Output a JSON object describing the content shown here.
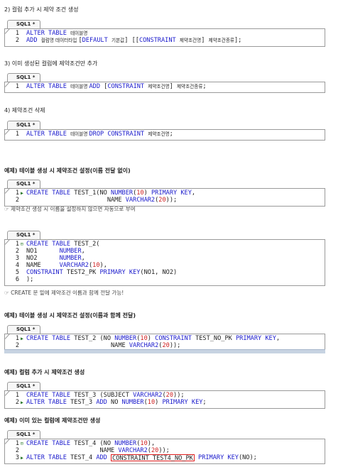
{
  "sections": {
    "s2": {
      "heading": "2) 컬럼 추가 시 제약 조건 생성",
      "tab": "SQL1 *",
      "lines": [
        {
          "n": "1",
          "parts": [
            [
              "kw",
              "ALTER TABLE "
            ],
            [
              "ko",
              "테이블명"
            ]
          ]
        },
        {
          "n": "2",
          "parts": [
            [
              "kw",
              "ADD "
            ],
            [
              "ko",
              "컬럼명 데이터타입 "
            ],
            [
              "txt",
              "["
            ],
            [
              "kw",
              "DEFAULT "
            ],
            [
              "ko",
              "기본값"
            ],
            [
              "txt",
              "] [["
            ],
            [
              "kw",
              "CONSTRAINT "
            ],
            [
              "ko",
              "제약조건명"
            ],
            [
              "txt",
              "] "
            ],
            [
              "ko",
              "제약조건종류"
            ],
            [
              "txt",
              "];"
            ]
          ]
        }
      ]
    },
    "s3": {
      "heading": "3) 이미 생성된 컬럼에 제약조건만 추가",
      "tab": "SQL1 *",
      "lines": [
        {
          "n": "1",
          "parts": [
            [
              "kw",
              "ALTER TABLE "
            ],
            [
              "ko",
              "테이블명 "
            ],
            [
              "kw",
              "ADD "
            ],
            [
              "txt",
              "["
            ],
            [
              "kw",
              "CONSTRAINT "
            ],
            [
              "ko",
              "제약조건명"
            ],
            [
              "txt",
              "] "
            ],
            [
              "ko",
              "제약조건종류"
            ],
            [
              "txt",
              ";"
            ]
          ]
        }
      ]
    },
    "s4": {
      "heading": "4) 제약조건 삭제",
      "tab": "SQL1 *",
      "lines": [
        {
          "n": "1",
          "parts": [
            [
              "kw",
              "ALTER TABLE "
            ],
            [
              "ko",
              "테이블명 "
            ],
            [
              "kw",
              "DROP CONSTRAINT "
            ],
            [
              "ko",
              "제약조건명"
            ],
            [
              "txt",
              ";"
            ]
          ]
        }
      ]
    },
    "ex1": {
      "heading": "예제) 테이블 생성 시 제약조건 설정(이름 전달 없이)",
      "tab": "SQL1 *",
      "lines": [
        {
          "n": "1",
          "mk": "▶",
          "parts": [
            [
              "kw",
              "CREATE TABLE "
            ],
            [
              "txt",
              "TEST_1(NO "
            ],
            [
              "kw",
              "NUMBER"
            ],
            [
              "txt",
              "("
            ],
            [
              "num",
              "10"
            ],
            [
              "txt",
              ") "
            ],
            [
              "kw",
              "PRIMARY KEY"
            ],
            [
              "txt",
              ","
            ]
          ]
        },
        {
          "n": "2",
          "parts": [
            [
              "txt",
              "                      NAME "
            ],
            [
              "kw",
              "VARCHAR2"
            ],
            [
              "txt",
              "("
            ],
            [
              "num",
              "20"
            ],
            [
              "txt",
              "));"
            ]
          ]
        }
      ],
      "note": "☞ 제약조건 생성 시 이름을 설정하지 않으면 자동으로 부여"
    },
    "ex2": {
      "tab": "SQL1 *",
      "lines": [
        {
          "n": "1",
          "mk": "⊟",
          "parts": [
            [
              "kw",
              "CREATE TABLE "
            ],
            [
              "txt",
              "TEST_2("
            ]
          ]
        },
        {
          "n": "2",
          "parts": [
            [
              "txt",
              "NO1      "
            ],
            [
              "kw",
              "NUMBER"
            ],
            [
              "txt",
              ","
            ]
          ]
        },
        {
          "n": "3",
          "parts": [
            [
              "txt",
              "NO2      "
            ],
            [
              "kw",
              "NUMBER"
            ],
            [
              "txt",
              ","
            ]
          ]
        },
        {
          "n": "4",
          "parts": [
            [
              "txt",
              "NAME     "
            ],
            [
              "kw",
              "VARCHAR2"
            ],
            [
              "txt",
              "("
            ],
            [
              "num",
              "10"
            ],
            [
              "txt",
              "),"
            ]
          ]
        },
        {
          "n": "5",
          "parts": [
            [
              "kw",
              "CONSTRAINT "
            ],
            [
              "txt",
              "TEST2_PK "
            ],
            [
              "kw",
              "PRIMARY KEY"
            ],
            [
              "txt",
              "(NO1, NO2)"
            ]
          ]
        },
        {
          "n": "6",
          "parts": [
            [
              "txt",
              ");"
            ]
          ]
        }
      ],
      "note": "☞ CREATE 문 밑에 제약조건 이름과 함께 전달 가능!"
    },
    "ex3": {
      "heading": "예제) 테이블 생성 시 제약조건 설정(이름과 함께 전달)",
      "tab": "SQL1 *",
      "lines": [
        {
          "n": "1",
          "mk": "▶",
          "parts": [
            [
              "kw",
              "CREATE TABLE "
            ],
            [
              "txt",
              "TEST_2 (NO "
            ],
            [
              "kw",
              "NUMBER"
            ],
            [
              "txt",
              "("
            ],
            [
              "num",
              "10"
            ],
            [
              "txt",
              ") "
            ],
            [
              "kw",
              "CONSTRAINT "
            ],
            [
              "txt",
              "TEST_NO_PK "
            ],
            [
              "kw",
              "PRIMARY KEY"
            ],
            [
              "txt",
              ","
            ]
          ]
        },
        {
          "n": "2",
          "parts": [
            [
              "txt",
              "                       NAME "
            ],
            [
              "kw",
              "VARCHAR2"
            ],
            [
              "txt",
              "("
            ],
            [
              "num",
              "20"
            ],
            [
              "txt",
              "));"
            ]
          ]
        }
      ]
    },
    "ex4": {
      "heading": "예제) 컬럼 추가 시 제약조건 생성",
      "tab": "SQL1 *",
      "lines": [
        {
          "n": "1",
          "parts": [
            [
              "kw",
              "CREATE TABLE "
            ],
            [
              "txt",
              "TEST_3 (SUBJECT "
            ],
            [
              "kw",
              "VARCHAR2"
            ],
            [
              "txt",
              "("
            ],
            [
              "num",
              "20"
            ],
            [
              "txt",
              "));"
            ]
          ]
        },
        {
          "n": "2",
          "mk": "▶",
          "parts": [
            [
              "kw",
              "ALTER TABLE "
            ],
            [
              "txt",
              "TEST_3 "
            ],
            [
              "kw",
              "ADD "
            ],
            [
              "txt",
              "NO "
            ],
            [
              "kw",
              "NUMBER"
            ],
            [
              "txt",
              "("
            ],
            [
              "num",
              "10"
            ],
            [
              "txt",
              ") "
            ],
            [
              "kw",
              "PRIMARY KEY"
            ],
            [
              "txt",
              ";"
            ]
          ]
        }
      ]
    },
    "ex5": {
      "heading": "예제) 이미 있는 컬럼에 제약조건만 생성",
      "tab": "SQL1 *",
      "lines": [
        {
          "n": "1",
          "mk": "⊟",
          "parts": [
            [
              "kw",
              "CREATE TABLE "
            ],
            [
              "txt",
              "TEST_4 (NO "
            ],
            [
              "kw",
              "NUMBER"
            ],
            [
              "txt",
              "("
            ],
            [
              "num",
              "10"
            ],
            [
              "txt",
              "),"
            ]
          ]
        },
        {
          "n": "2",
          "parts": [
            [
              "txt",
              "                    NAME "
            ],
            [
              "kw",
              "VARCHAR2"
            ],
            [
              "txt",
              "("
            ],
            [
              "num",
              "20"
            ],
            [
              "txt",
              "));"
            ]
          ]
        },
        {
          "n": "3",
          "mk": "▶",
          "parts": [
            [
              "kw",
              "ALTER TABLE "
            ],
            [
              "txt",
              "TEST_4 "
            ],
            [
              "kw",
              "ADD "
            ],
            [
              "hl",
              "CONSTRAINT TEST4_NO_PK"
            ],
            [
              "txt",
              " "
            ],
            [
              "kw",
              "PRIMARY KEY"
            ],
            [
              "txt",
              "(NO);"
            ]
          ]
        }
      ]
    }
  }
}
